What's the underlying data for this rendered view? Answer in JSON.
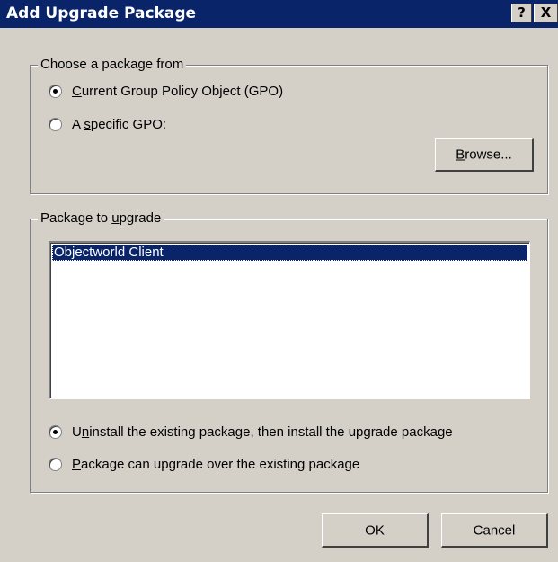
{
  "window": {
    "title": "Add Upgrade Package",
    "help_label": "?",
    "close_label": "X"
  },
  "source_group": {
    "legend": "Choose a package from",
    "option_current": {
      "accel": "C",
      "rest": "urrent Group Policy Object (GPO)",
      "checked": true
    },
    "option_specific": {
      "pre": "A ",
      "accel": "s",
      "rest": "pecific GPO:",
      "checked": false
    },
    "browse": {
      "accel": "B",
      "rest": "rowse..."
    }
  },
  "package_group": {
    "legend_pre": "Package to ",
    "legend_accel": "u",
    "legend_rest": "pgrade",
    "items": [
      "Objectworld Client"
    ],
    "selected_index": 0,
    "option_uninstall": {
      "pre": "U",
      "accel": "n",
      "rest": "install the existing package, then install the upgrade package",
      "checked": true
    },
    "option_over": {
      "accel": "P",
      "rest": "ackage can upgrade over the existing package",
      "checked": false
    }
  },
  "buttons": {
    "ok": "OK",
    "cancel": "Cancel"
  }
}
